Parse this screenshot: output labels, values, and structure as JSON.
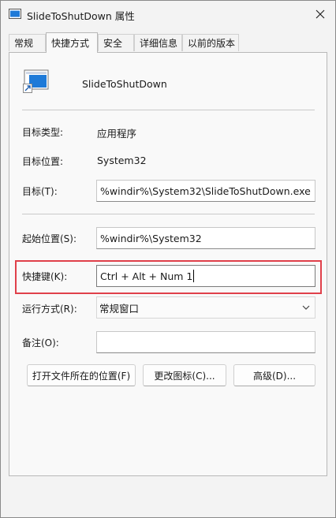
{
  "window": {
    "title": "SlideToShutDown 属性"
  },
  "tabs": [
    {
      "label": "常规"
    },
    {
      "label": "快捷方式"
    },
    {
      "label": "安全"
    },
    {
      "label": "详细信息"
    },
    {
      "label": "以前的版本"
    }
  ],
  "shortcut": {
    "name": "SlideToShutDown",
    "target_type_label": "目标类型:",
    "target_type_value": "应用程序",
    "target_location_label": "目标位置:",
    "target_location_value": "System32",
    "target_label": "目标(T):",
    "target_value": "%windir%\\System32\\SlideToShutDown.exe",
    "start_in_label": "起始位置(S):",
    "start_in_value": "%windir%\\System32",
    "hotkey_label": "快捷键(K):",
    "hotkey_value": "Ctrl + Alt + Num 1",
    "run_label": "运行方式(R):",
    "run_value": "常规窗口",
    "comment_label": "备注(O):",
    "comment_value": ""
  },
  "buttons": {
    "open_location": "打开文件所在的位置(F)",
    "change_icon": "更改图标(C)...",
    "advanced": "高级(D)..."
  },
  "colors": {
    "highlight": "#e0404a",
    "icon_blue": "#1e7ad8"
  }
}
